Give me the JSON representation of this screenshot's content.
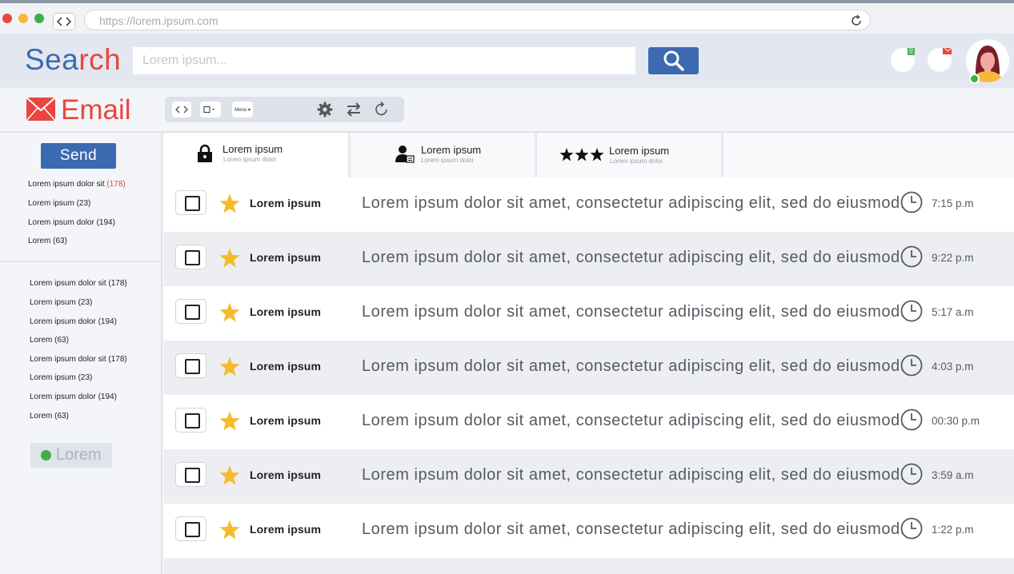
{
  "browser": {
    "url": "https://lorem.ipsum.com",
    "traffic_lights": [
      "#e5483f",
      "#f5b83a",
      "#3fae49"
    ]
  },
  "header": {
    "logo_text": "Search",
    "search_placeholder": "Lorem ipsum...",
    "accent_colors": {
      "blue": "#3c6ab0",
      "orange": "#e8463f"
    }
  },
  "email": {
    "title": "Email",
    "toolbar": {
      "menu_label": "Menu ▾"
    }
  },
  "sidebar": {
    "send_label": "Send",
    "group1": [
      {
        "label": "Lorem ipsum dolor sit",
        "count": "(178)",
        "highlight": true
      },
      {
        "label": "Lorem ipsum",
        "count": "(23)"
      },
      {
        "label": "Lorem ipsum dolor",
        "count": "(194)"
      },
      {
        "label": "Lorem",
        "count": "(63)"
      }
    ],
    "group2": [
      "Lorem ipsum dolor sit (178)",
      "Lorem ipsum (23)",
      "Lorem ipsum dolor (194)",
      "Lorem (63)",
      "Lorem ipsum dolor sit (178)",
      "Lorem ipsum (23)",
      "Lorem ipsum dolor (194)",
      "Lorem (63)"
    ],
    "status_label": "Lorem"
  },
  "tabs": [
    {
      "title": "Lorem ipsum",
      "subtitle": "Lorem ipsum dolor",
      "icon": "lock-icon"
    },
    {
      "title": "Lorem ipsum",
      "subtitle": "Lorem ipsum dolor",
      "icon": "person-icon"
    },
    {
      "title": "Lorem ipsum",
      "subtitle": "Lorem ipsum dolor",
      "icon": "three-stars-icon"
    }
  ],
  "messages": [
    {
      "sender": "Lorem ipsum",
      "preview": "Lorem ipsum dolor sit amet, consectetur adipiscing elit, sed do eiusmod.",
      "time": "7:15 p.m"
    },
    {
      "sender": "Lorem ipsum",
      "preview": "Lorem ipsum dolor sit amet, consectetur adipiscing elit, sed do eiusmod.",
      "time": "9:22 p.m"
    },
    {
      "sender": "Lorem ipsum",
      "preview": "Lorem ipsum dolor sit amet, consectetur adipiscing elit, sed do eiusmod.",
      "time": "5:17 a.m"
    },
    {
      "sender": "Lorem ipsum",
      "preview": "Lorem ipsum dolor sit amet, consectetur adipiscing elit, sed do eiusmod.",
      "time": "4:03 p.m"
    },
    {
      "sender": "Lorem ipsum",
      "preview": "Lorem ipsum dolor sit amet, consectetur adipiscing elit, sed do eiusmod.",
      "time": "00:30 p.m"
    },
    {
      "sender": "Lorem ipsum",
      "preview": "Lorem ipsum dolor sit amet, consectetur adipiscing elit, sed do eiusmod.",
      "time": "3:59 a.m"
    },
    {
      "sender": "Lorem ipsum",
      "preview": "Lorem ipsum dolor sit amet, consectetur adipiscing elit, sed do eiusmod.",
      "time": "1:22 p.m"
    }
  ]
}
